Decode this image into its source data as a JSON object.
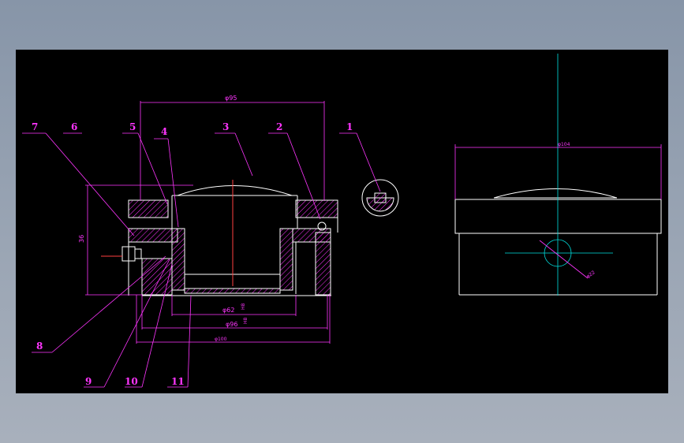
{
  "drawing": {
    "part_labels": [
      "1",
      "2",
      "3",
      "4",
      "5",
      "6",
      "7",
      "8",
      "9",
      "10",
      "11"
    ],
    "dimensions": {
      "top_width": "φ95",
      "height": "36",
      "inner_bore": "φ62",
      "inner_bore_tol": "H8",
      "mid_width": "φ96",
      "mid_width_tol": "H8",
      "bottom_width": "φ100",
      "side_view_width": "φ104",
      "side_view_hole": "φ22"
    },
    "colors": {
      "background": "#000000",
      "outline": "#ffffff",
      "dimension": "#ff35ff",
      "center_line": "#00e0e0",
      "axis_line": "#ff4040",
      "hatch": "#ff35ff"
    }
  }
}
